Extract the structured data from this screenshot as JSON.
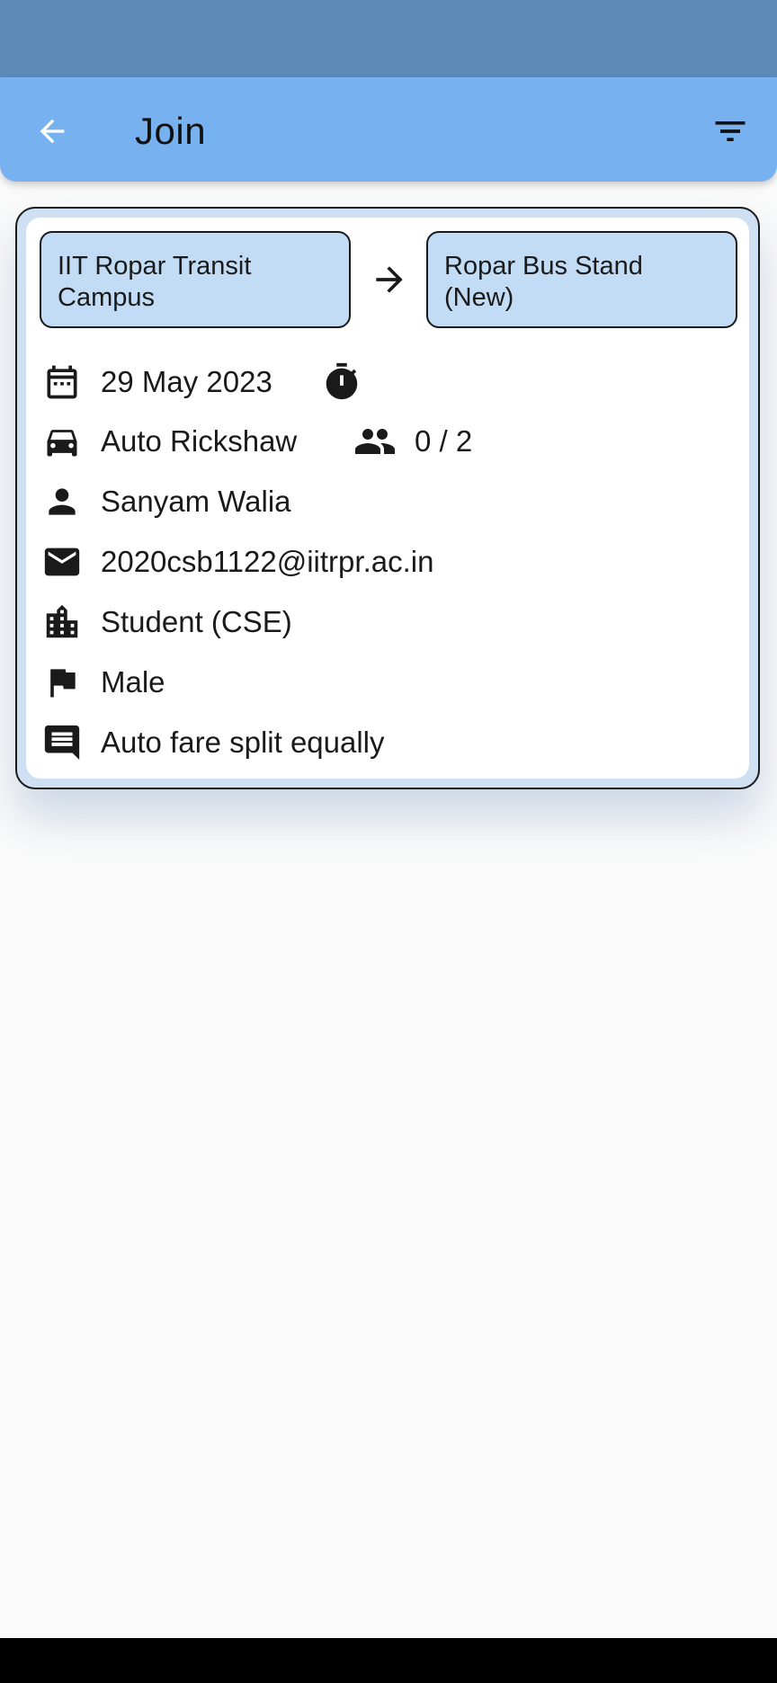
{
  "app_bar": {
    "title": "Join",
    "back_icon": "arrow-back-icon",
    "filter_icon": "filter-list-icon"
  },
  "ride": {
    "from": "IIT Ropar Transit Campus",
    "to": "Ropar Bus Stand (New)",
    "date": "29 May 2023",
    "vehicle": "Auto Rickshaw",
    "seats": "0 / 2",
    "name": "Sanyam Walia",
    "email": "2020csb1122@iitrpr.ac.in",
    "role": "Student (CSE)",
    "gender": "Male",
    "note": "Auto fare split equally"
  },
  "colors": {
    "status_bar": "#5b8ab7",
    "app_bar": "#77b1ef",
    "location_box": "#c2dcf6",
    "background": "#fafafa"
  }
}
